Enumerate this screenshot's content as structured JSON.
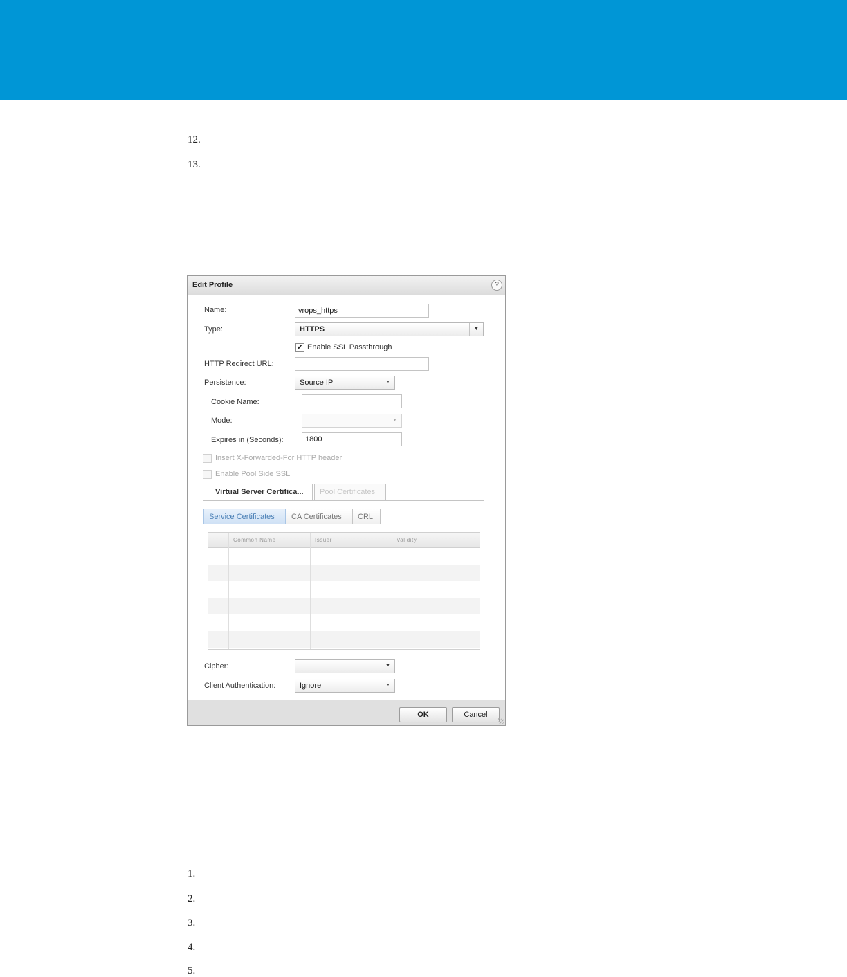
{
  "steps_top": [
    "12.",
    "13."
  ],
  "steps_bottom": [
    "1.",
    "2.",
    "3.",
    "4.",
    "5."
  ],
  "dialog": {
    "title": "Edit Profile",
    "help_icon_glyph": "?",
    "name_label": "Name:",
    "name_value": "vrops_https",
    "type_label": "Type:",
    "type_value": "HTTPS",
    "ssl_passthrough_label": "Enable SSL Passthrough",
    "ssl_passthrough_checked": true,
    "redirect_label": "HTTP Redirect URL:",
    "redirect_value": "",
    "persistence_label": "Persistence:",
    "persistence_value": "Source IP",
    "cookie_label": "Cookie Name:",
    "cookie_value": "",
    "mode_label": "Mode:",
    "mode_value": "",
    "expires_label": "Expires in (Seconds):",
    "expires_value": "1800",
    "xff_label": "Insert X-Forwarded-For HTTP header",
    "pool_ssl_label": "Enable Pool Side SSL",
    "tabs": [
      "Virtual Server Certifica...",
      "Pool Certificates"
    ],
    "subtabs": [
      "Service Certificates",
      "CA Certificates",
      "CRL"
    ],
    "columns": [
      "Common Name",
      "Issuer",
      "Validity"
    ],
    "cipher_label": "Cipher:",
    "cipher_value": "",
    "client_auth_label": "Client Authentication:",
    "client_auth_value": "Ignore",
    "ok_label": "OK",
    "cancel_label": "Cancel"
  },
  "colors": {
    "band": "#0096d6",
    "subtab_active": "#4a7fb5"
  },
  "icons": {
    "help": "help-icon",
    "dropdown": "chevron-down-icon",
    "check": "checkmark-icon"
  }
}
